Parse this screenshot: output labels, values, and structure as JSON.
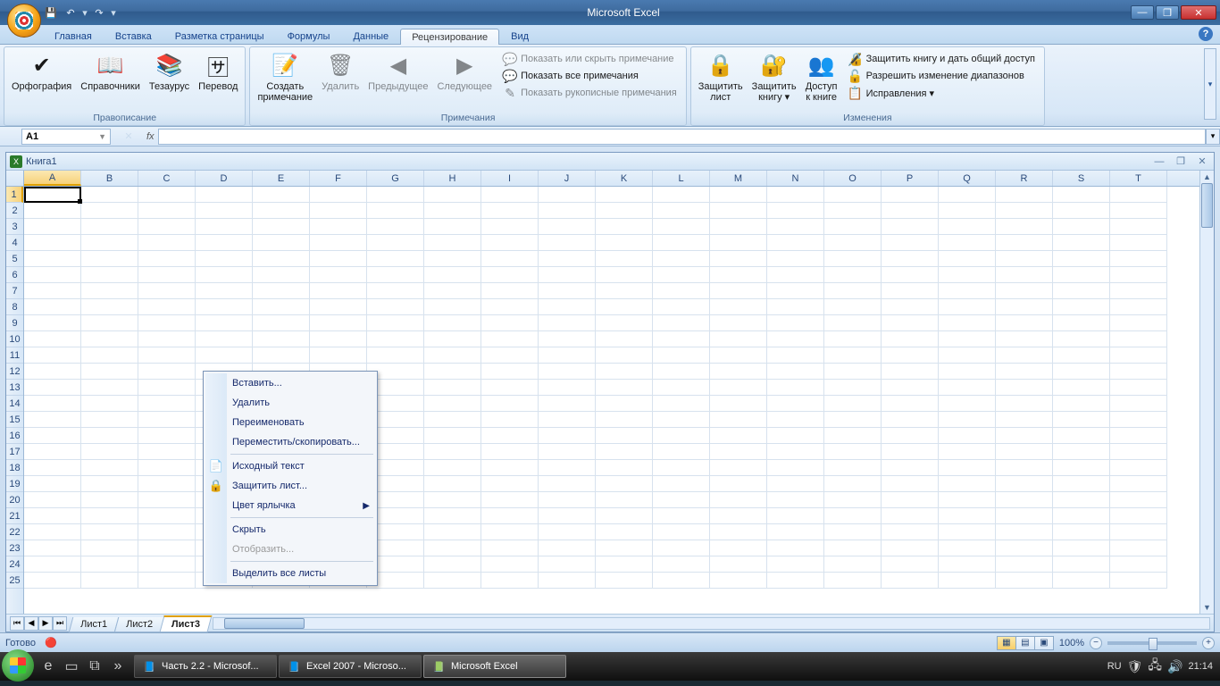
{
  "app_title": "Microsoft Excel",
  "tabs": {
    "home": "Главная",
    "insert": "Вставка",
    "layout": "Разметка страницы",
    "formulas": "Формулы",
    "data": "Данные",
    "review": "Рецензирование",
    "view": "Вид"
  },
  "ribbon": {
    "proofing": {
      "spelling": "Орфография",
      "research": "Справочники",
      "thesaurus": "Тезаурус",
      "translate": "Перевод",
      "group": "Правописание"
    },
    "comments": {
      "new": "Создать\nпримечание",
      "delete": "Удалить",
      "prev": "Предыдущее",
      "next": "Следующее",
      "show_hide": "Показать или скрыть примечание",
      "show_all": "Показать все примечания",
      "show_ink": "Показать рукописные примечания",
      "group": "Примечания"
    },
    "protect": {
      "sheet": "Защитить\nлист",
      "book": "Защитить\nкнигу ▾",
      "share": "Доступ\nк книге",
      "share_protect": "Защитить книгу и дать общий доступ",
      "allow_ranges": "Разрешить изменение диапазонов",
      "track": "Исправления ▾",
      "group": "Изменения"
    }
  },
  "namebox": "A1",
  "workbook": "Книга1",
  "columns": [
    "A",
    "B",
    "C",
    "D",
    "E",
    "F",
    "G",
    "H",
    "I",
    "J",
    "K",
    "L",
    "M",
    "N",
    "O",
    "P",
    "Q",
    "R",
    "S",
    "T"
  ],
  "rows": [
    "1",
    "2",
    "3",
    "4",
    "5",
    "6",
    "7",
    "8",
    "9",
    "10",
    "11",
    "12",
    "13",
    "14",
    "15",
    "16",
    "17",
    "18",
    "19",
    "20",
    "21",
    "22",
    "23",
    "24",
    "25"
  ],
  "sheets": {
    "s1": "Лист1",
    "s2": "Лист2",
    "s3": "Лист3"
  },
  "ctx": {
    "insert": "Вставить...",
    "delete": "Удалить",
    "rename": "Переименовать",
    "move": "Переместить/скопировать...",
    "source": "Исходный текст",
    "protect": "Защитить лист...",
    "color": "Цвет ярлычка",
    "hide": "Скрыть",
    "unhide": "Отобразить...",
    "select_all": "Выделить все листы"
  },
  "status": {
    "ready": "Готово",
    "zoom": "100%"
  },
  "taskbar": {
    "t1": "Часть 2.2 - Microsof...",
    "t2": "Excel 2007 - Microso...",
    "t3": "Microsoft Excel",
    "lang": "RU",
    "time": "21:14"
  }
}
